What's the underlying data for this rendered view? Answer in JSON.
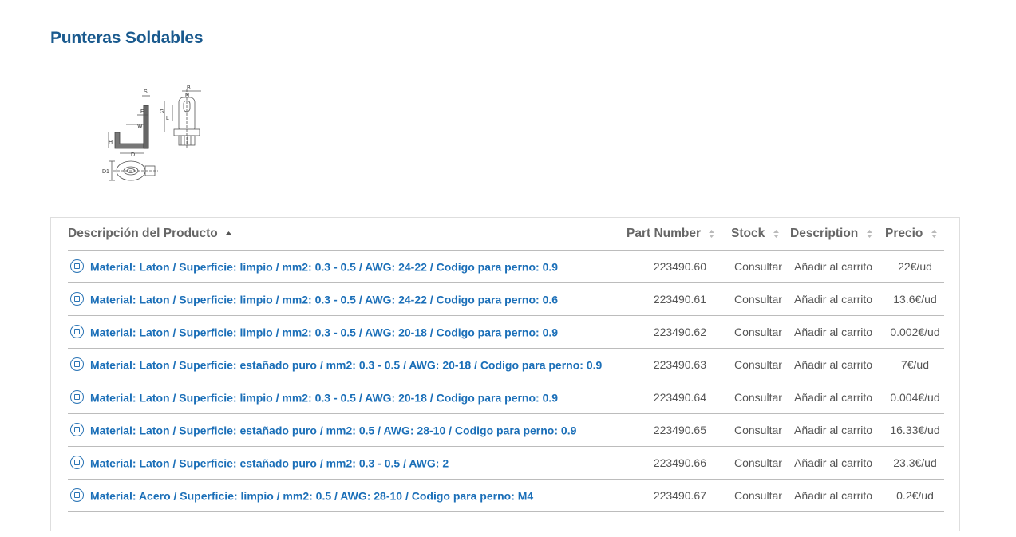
{
  "page": {
    "title": "Punteras Soldables"
  },
  "diagram": {
    "labels": [
      "S",
      "B",
      "N",
      "E",
      "G",
      "L",
      "W",
      "H",
      "D",
      "D1"
    ]
  },
  "table": {
    "columns": {
      "description": "Descripción del Producto",
      "part_number": "Part Number",
      "stock": "Stock",
      "description2": "Description",
      "price": "Precio"
    },
    "sort": {
      "column": "description",
      "direction": "ascending"
    },
    "rows": [
      {
        "description": "Material: Laton / Superficie: limpio / mm2: 0.3 - 0.5 / AWG: 24-22 / Codigo para perno: 0.9",
        "part_number": "223490.60",
        "stock": "Consultar",
        "action": "Añadir al carrito",
        "price": "22€/ud"
      },
      {
        "description": "Material: Laton / Superficie: limpio / mm2: 0.3 - 0.5 / AWG: 24-22 / Codigo para perno: 0.6",
        "part_number": "223490.61",
        "stock": "Consultar",
        "action": "Añadir al carrito",
        "price": "13.6€/ud"
      },
      {
        "description": "Material: Laton / Superficie: limpio / mm2: 0.3 - 0.5 / AWG: 20-18 / Codigo para perno: 0.9",
        "part_number": "223490.62",
        "stock": "Consultar",
        "action": "Añadir al carrito",
        "price": "0.002€/ud"
      },
      {
        "description": "Material: Laton / Superficie: estañado puro / mm2: 0.3 - 0.5 / AWG: 20-18 / Codigo para perno: 0.9",
        "part_number": "223490.63",
        "stock": "Consultar",
        "action": "Añadir al carrito",
        "price": "7€/ud"
      },
      {
        "description": "Material: Laton / Superficie: limpio / mm2: 0.3 - 0.5 / AWG: 20-18 / Codigo para perno: 0.9",
        "part_number": "223490.64",
        "stock": "Consultar",
        "action": "Añadir al carrito",
        "price": "0.004€/ud"
      },
      {
        "description": "Material: Laton / Superficie: estañado puro / mm2: 0.5 / AWG: 28-10 / Codigo para perno: 0.9",
        "part_number": "223490.65",
        "stock": "Consultar",
        "action": "Añadir al carrito",
        "price": "16.33€/ud"
      },
      {
        "description": "Material: Laton / Superficie: estañado puro / mm2: 0.3 - 0.5 / AWG: 2",
        "part_number": "223490.66",
        "stock": "Consultar",
        "action": "Añadir al carrito",
        "price": "23.3€/ud"
      },
      {
        "description": "Material: Acero / Superficie: limpio / mm2: 0.5 / AWG: 28-10 / Codigo para perno: M4",
        "part_number": "223490.67",
        "stock": "Consultar",
        "action": "Añadir al carrito",
        "price": "0.2€/ud"
      }
    ]
  },
  "colors": {
    "title": "#1a5a8e",
    "link": "#1b6fb8",
    "header_text": "#666666",
    "border": "#bcbcbc"
  }
}
